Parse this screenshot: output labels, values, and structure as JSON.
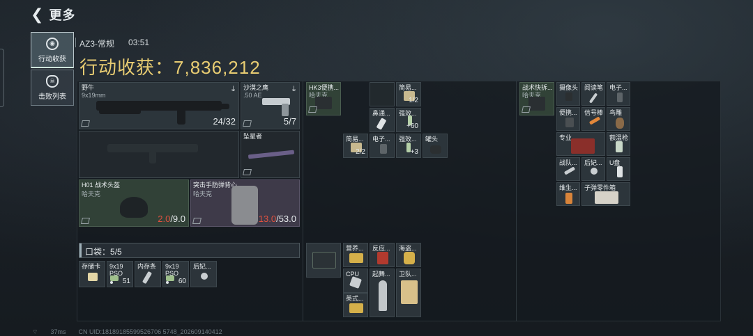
{
  "header": {
    "title": "更多"
  },
  "tabs": [
    {
      "label": "行动收获",
      "active": true
    },
    {
      "label": "击败列表",
      "active": false
    }
  ],
  "mission": {
    "map": "AZ3-常规",
    "time": "03:51"
  },
  "earnings": {
    "label": "行动收获：",
    "value": "7,836,212"
  },
  "loadout": {
    "primary": {
      "name": "野牛",
      "caliber": "9x19mm",
      "ammo": "24/32"
    },
    "secondary": {
      "name": "沙漠之鹰",
      "caliber": ".50 AE",
      "ammo": "5/7"
    },
    "melee": {
      "name": "坠星者"
    },
    "helmet": {
      "name": "H01 战术头盔",
      "brand": "哈夫克",
      "durability_current": "2.0",
      "durability_max": "/9.0"
    },
    "armor": {
      "name": "突击手防弹背心",
      "brand": "哈夫克",
      "durability_current": "13.0",
      "durability_max": "/53.0"
    }
  },
  "rig": {
    "name": "HK3便携...",
    "brand": "哈夫克",
    "items": [
      {
        "name": "简易...",
        "count": "1/2"
      },
      {
        "name": "鼻通..."
      },
      {
        "name": "强效...",
        "count": "+60"
      },
      {
        "name": "简易...",
        "count": "2/2"
      },
      {
        "name": "电子..."
      },
      {
        "name": "强效...",
        "count": "+3"
      },
      {
        "name": "罐头"
      }
    ]
  },
  "backpack": {
    "name": "战术快拆...",
    "brand": "哈夫克",
    "items": [
      {
        "name": "摄像头"
      },
      {
        "name": "阅读笔"
      },
      {
        "name": "电子..."
      },
      {
        "name": "便携..."
      },
      {
        "name": "信号棒"
      },
      {
        "name": "鸟雕"
      },
      {
        "name": "专业..."
      },
      {
        "name": "额温枪"
      },
      {
        "name": "战队..."
      },
      {
        "name": "后妃..."
      },
      {
        "name": "U盘"
      },
      {
        "name": "维生..."
      },
      {
        "name": "子弹零件箱"
      }
    ]
  },
  "pocket": {
    "label": "口袋：",
    "count": "5/5",
    "items": [
      {
        "name": "存储卡"
      },
      {
        "name": "9x19 PSO",
        "count": "51"
      },
      {
        "name": "内存条"
      },
      {
        "name": "9x19 PSO",
        "count": "60"
      },
      {
        "name": "后妃..."
      }
    ]
  },
  "safebox": {
    "items": [
      {
        "name": "营养..."
      },
      {
        "name": "反应..."
      },
      {
        "name": "海盗..."
      },
      {
        "name": "CPU"
      },
      {
        "name": "起舞..."
      },
      {
        "name": "卫队..."
      },
      {
        "name": "英式..."
      }
    ]
  },
  "footer": {
    "ping": "37ms",
    "uid": "CN UID:18189185599526706 5748_202609140412"
  }
}
